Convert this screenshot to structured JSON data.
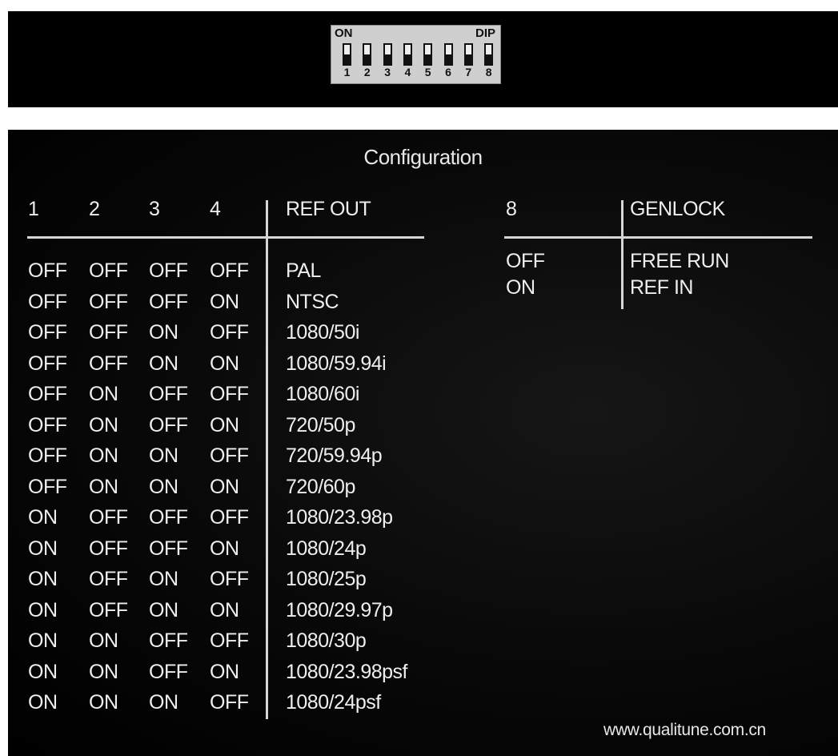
{
  "dip_switch": {
    "on_label": "ON",
    "dip_label": "DIP",
    "switches": [
      "1",
      "2",
      "3",
      "4",
      "5",
      "6",
      "7",
      "8"
    ]
  },
  "config": {
    "title": "Configuration",
    "ref_table": {
      "headers": [
        "1",
        "2",
        "3",
        "4",
        "REF OUT"
      ],
      "rows": [
        [
          "OFF",
          "OFF",
          "OFF",
          "OFF",
          "PAL"
        ],
        [
          "OFF",
          "OFF",
          "OFF",
          "ON",
          "NTSC"
        ],
        [
          "OFF",
          "OFF",
          "ON",
          "OFF",
          "1080/50i"
        ],
        [
          "OFF",
          "OFF",
          "ON",
          "ON",
          "1080/59.94i"
        ],
        [
          "OFF",
          "ON",
          "OFF",
          "OFF",
          "1080/60i"
        ],
        [
          "OFF",
          "ON",
          "OFF",
          "ON",
          "720/50p"
        ],
        [
          "OFF",
          "ON",
          "ON",
          "OFF",
          "720/59.94p"
        ],
        [
          "OFF",
          "ON",
          "ON",
          "ON",
          "720/60p"
        ],
        [
          "ON",
          "OFF",
          "OFF",
          "OFF",
          "1080/23.98p"
        ],
        [
          "ON",
          "OFF",
          "OFF",
          "ON",
          "1080/24p"
        ],
        [
          "ON",
          "OFF",
          "ON",
          "OFF",
          "1080/25p"
        ],
        [
          "ON",
          "OFF",
          "ON",
          "ON",
          "1080/29.97p"
        ],
        [
          "ON",
          "ON",
          "OFF",
          "OFF",
          "1080/30p"
        ],
        [
          "ON",
          "ON",
          "OFF",
          "ON",
          "1080/23.98psf"
        ],
        [
          "ON",
          "ON",
          "ON",
          "OFF",
          "1080/24psf"
        ]
      ]
    },
    "genlock_table": {
      "headers": [
        "8",
        "GENLOCK"
      ],
      "rows": [
        [
          "OFF",
          "FREE RUN"
        ],
        [
          "ON",
          "REF IN"
        ]
      ]
    },
    "footer": "www.qualitune.com.cn"
  }
}
